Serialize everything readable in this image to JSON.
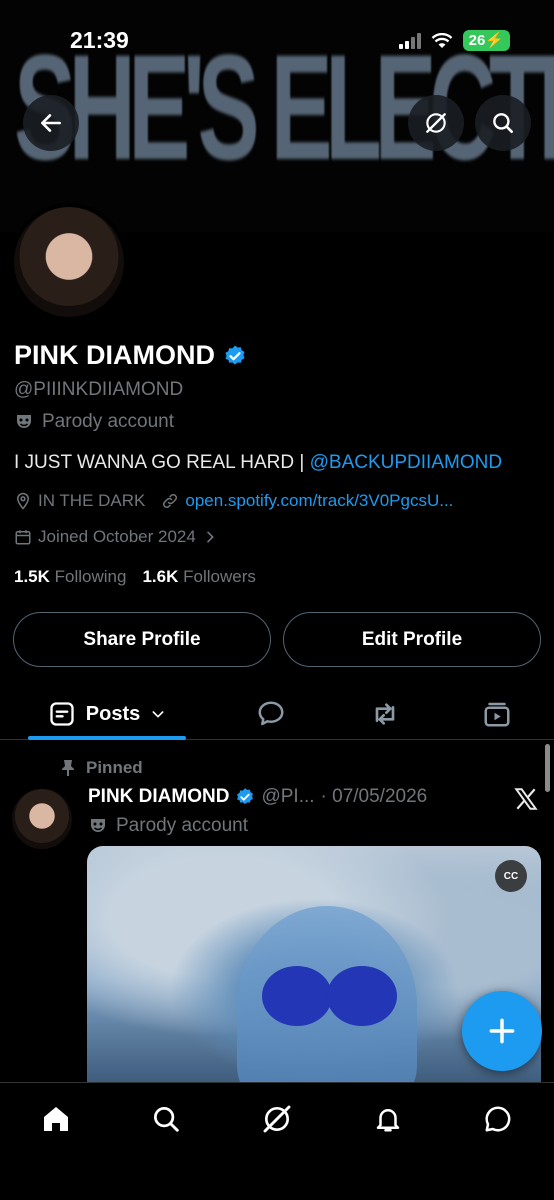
{
  "status_bar": {
    "time": "21:39",
    "battery": "26"
  },
  "banner": {
    "text": "SHE'S ELECTRIC"
  },
  "profile": {
    "name": "PINK DIAMOND",
    "handle": "@PIIINKDIIAMOND",
    "parody_label": "Parody account",
    "bio_text": "I JUST WANNA GO REAL HARD | ",
    "bio_mention": "@BACKUPDIIAMOND",
    "location": "IN THE DARK",
    "link": "open.spotify.com/track/3V0PgcsU...",
    "joined": "Joined October 2024",
    "following_count": "1.5K",
    "following_label": "Following",
    "followers_count": "1.6K",
    "followers_label": "Followers"
  },
  "buttons": {
    "share": "Share Profile",
    "edit": "Edit Profile"
  },
  "tabs": {
    "posts": "Posts"
  },
  "pinned_post": {
    "pinned_label": "Pinned",
    "author": "PINK DIAMOND",
    "handle": "@PI...",
    "date": "· 07/05/2026",
    "parody_label": "Parody account",
    "cc": "CC"
  },
  "colors": {
    "accent": "#1d9bf0",
    "background": "#000000",
    "muted": "#71767b",
    "border": "#2f3336"
  }
}
